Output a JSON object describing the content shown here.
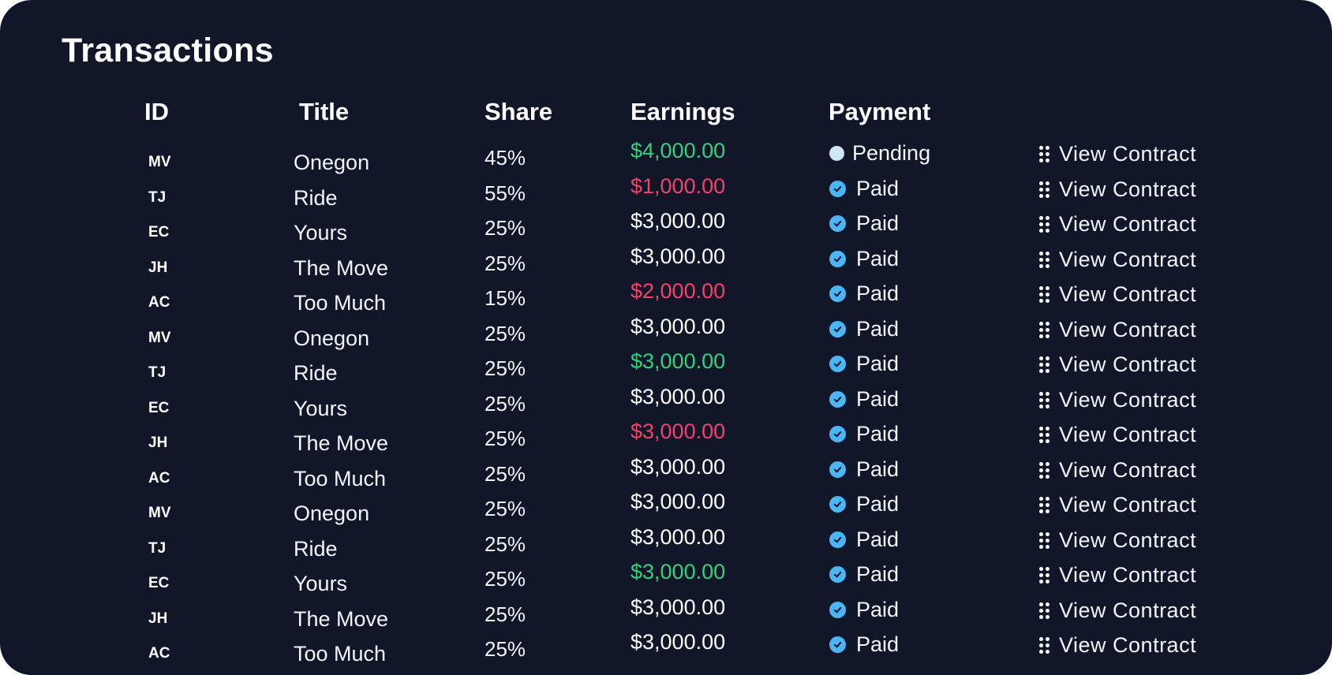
{
  "page": {
    "title": "Transactions"
  },
  "columns": {
    "id": "ID",
    "title": "Title",
    "share": "Share",
    "earnings": "Earnings",
    "payment": "Payment"
  },
  "colors": {
    "background": "#111729",
    "positive": "#34d17d",
    "negative": "#f2436b",
    "paid_icon": "#4ab6f5",
    "pending_icon": "#cfe6f7"
  },
  "rows": [
    {
      "id": "MV",
      "title": "Onegon",
      "share": "45%",
      "earnings": "$4,000.00",
      "tone": "pos",
      "payment": "Pending",
      "status": "pending",
      "action": "View Contract"
    },
    {
      "id": "TJ",
      "title": "Ride",
      "share": "55%",
      "earnings": "$1,000.00",
      "tone": "neg",
      "payment": "Paid",
      "status": "paid",
      "action": "View Contract"
    },
    {
      "id": "EC",
      "title": "Yours",
      "share": "25%",
      "earnings": "$3,000.00",
      "tone": "neutral",
      "payment": "Paid",
      "status": "paid",
      "action": "View Contract"
    },
    {
      "id": "JH",
      "title": "The Move",
      "share": "25%",
      "earnings": "$3,000.00",
      "tone": "neutral",
      "payment": "Paid",
      "status": "paid",
      "action": "View Contract"
    },
    {
      "id": "AC",
      "title": "Too Much",
      "share": "15%",
      "earnings": "$2,000.00",
      "tone": "neg",
      "payment": "Paid",
      "status": "paid",
      "action": "View Contract"
    },
    {
      "id": "MV",
      "title": "Onegon",
      "share": "25%",
      "earnings": "$3,000.00",
      "tone": "neutral",
      "payment": "Paid",
      "status": "paid",
      "action": "View Contract"
    },
    {
      "id": "TJ",
      "title": "Ride",
      "share": "25%",
      "earnings": "$3,000.00",
      "tone": "pos",
      "payment": "Paid",
      "status": "paid",
      "action": "View Contract"
    },
    {
      "id": "EC",
      "title": "Yours",
      "share": "25%",
      "earnings": "$3,000.00",
      "tone": "neutral",
      "payment": "Paid",
      "status": "paid",
      "action": "View Contract"
    },
    {
      "id": "JH",
      "title": "The Move",
      "share": "25%",
      "earnings": "$3,000.00",
      "tone": "neg",
      "payment": "Paid",
      "status": "paid",
      "action": "View Contract"
    },
    {
      "id": "AC",
      "title": "Too Much",
      "share": "25%",
      "earnings": "$3,000.00",
      "tone": "neutral",
      "payment": "Paid",
      "status": "paid",
      "action": "View Contract"
    },
    {
      "id": "MV",
      "title": "Onegon",
      "share": "25%",
      "earnings": "$3,000.00",
      "tone": "neutral",
      "payment": "Paid",
      "status": "paid",
      "action": "View Contract"
    },
    {
      "id": "TJ",
      "title": "Ride",
      "share": "25%",
      "earnings": "$3,000.00",
      "tone": "neutral",
      "payment": "Paid",
      "status": "paid",
      "action": "View Contract"
    },
    {
      "id": "EC",
      "title": "Yours",
      "share": "25%",
      "earnings": "$3,000.00",
      "tone": "pos",
      "payment": "Paid",
      "status": "paid",
      "action": "View Contract"
    },
    {
      "id": "JH",
      "title": "The Move",
      "share": "25%",
      "earnings": "$3,000.00",
      "tone": "neutral",
      "payment": "Paid",
      "status": "paid",
      "action": "View Contract"
    },
    {
      "id": "AC",
      "title": "Too Much",
      "share": "25%",
      "earnings": "$3,000.00",
      "tone": "neutral",
      "payment": "Paid",
      "status": "paid",
      "action": "View Contract"
    }
  ]
}
